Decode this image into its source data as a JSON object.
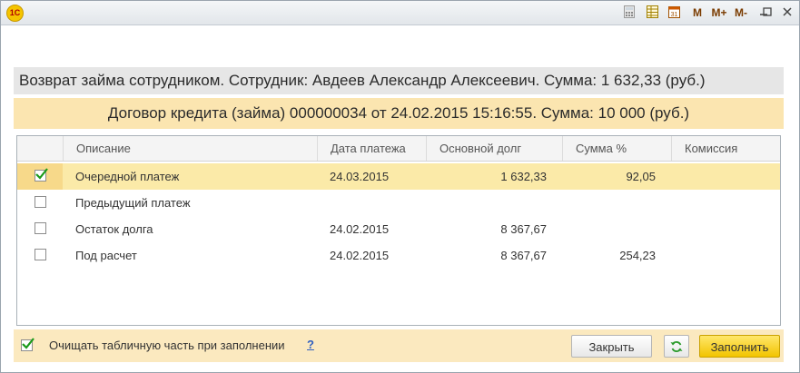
{
  "window": {
    "logo_text": "1С",
    "controls": {
      "calc_icon": "calculator-icon",
      "calendar_icon": "calendar-icon",
      "m": "M",
      "m_plus": "M+",
      "m_minus": "M-",
      "minimize": "—",
      "maximize": "□",
      "close": "✕"
    }
  },
  "header": {
    "title": "Возврат займа сотрудником. Сотрудник: Авдеев Александр Алексеевич. Сумма: 1 632,33 (руб.)",
    "contract": "Договор кредита (займа) 000000034 от 24.02.2015 15:16:55. Сумма: 10 000 (руб.)"
  },
  "table": {
    "columns": [
      "Описание",
      "Дата платежа",
      "Основной долг",
      "Сумма %",
      "Комиссия"
    ],
    "rows": [
      {
        "checked": true,
        "description": "Очередной платеж",
        "date": "24.03.2015",
        "principal": "1 632,33",
        "interest": "92,05",
        "commission": ""
      },
      {
        "checked": false,
        "description": "Предыдущий платеж",
        "date": "",
        "principal": "",
        "interest": "",
        "commission": ""
      },
      {
        "checked": false,
        "description": "Остаток долга",
        "date": "24.02.2015",
        "principal": "8 367,67",
        "interest": "",
        "commission": ""
      },
      {
        "checked": false,
        "description": "Под расчет",
        "date": "24.02.2015",
        "principal": "8 367,67",
        "interest": "254,23",
        "commission": ""
      }
    ]
  },
  "footer": {
    "clear_checkbox_checked": true,
    "clear_label": "Очищать табличную часть при заполнении",
    "help": "?",
    "close_button": "Закрыть",
    "fill_button": "Заполнить"
  },
  "colors": {
    "selected_row": "#fbeaa8",
    "header_band": "#fbe5b0",
    "accent": "#f2c400",
    "check": "#1a9a1a"
  }
}
